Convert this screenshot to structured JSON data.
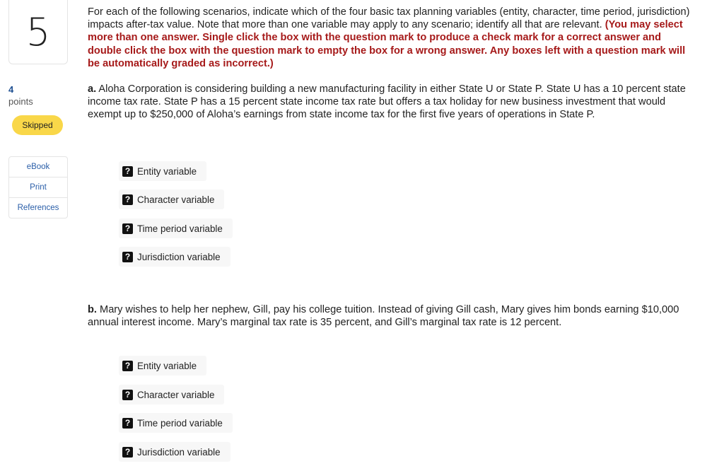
{
  "question": {
    "number": "5",
    "points_value": "4",
    "points_label": "points",
    "status": "Skipped",
    "status_color": "#f9d749"
  },
  "tools": [
    {
      "label": "eBook"
    },
    {
      "label": "Print"
    },
    {
      "label": "References"
    }
  ],
  "instructions": {
    "text": "For each of the following scenarios, indicate which of the four basic tax planning variables (entity, character, time period, jurisdiction) impacts after-tax value. Note that more than one variable may apply to any scenario; identify all that are relevant. ",
    "emphasis": "(You may select more than one answer. Single click the box with the question mark to produce a check mark for a correct answer and double click the box with the question mark to empty the box for a wrong answer. Any boxes left with a question mark will be automatically graded as incorrect.)",
    "emphasis_color": "#a61a1a"
  },
  "scenarios": [
    {
      "letter": "a.",
      "text": " Aloha Corporation is considering building a new manufacturing facility in either State U or State P. State U has a 10 percent state income tax rate. State P has a 15 percent state income tax rate but offers a tax holiday for new business investment that would exempt up to $250,000 of Aloha’s earnings from state income tax for the first five years of operations in State P.",
      "options": [
        {
          "label": "Entity variable",
          "state": "?"
        },
        {
          "label": "Character variable",
          "state": "?"
        },
        {
          "label": "Time period variable",
          "state": "?"
        },
        {
          "label": "Jurisdiction variable",
          "state": "?"
        }
      ]
    },
    {
      "letter": "b.",
      "text": " Mary wishes to help her nephew, Gill, pay his college tuition. Instead of giving Gill cash, Mary gives him bonds earning $10,000 annual interest income. Mary’s marginal tax rate is 35 percent, and Gill’s marginal tax rate is 12 percent.",
      "options": [
        {
          "label": "Entity variable",
          "state": "?"
        },
        {
          "label": "Character variable",
          "state": "?"
        },
        {
          "label": "Time period variable",
          "state": "?"
        },
        {
          "label": "Jurisdiction variable",
          "state": "?"
        }
      ]
    }
  ]
}
